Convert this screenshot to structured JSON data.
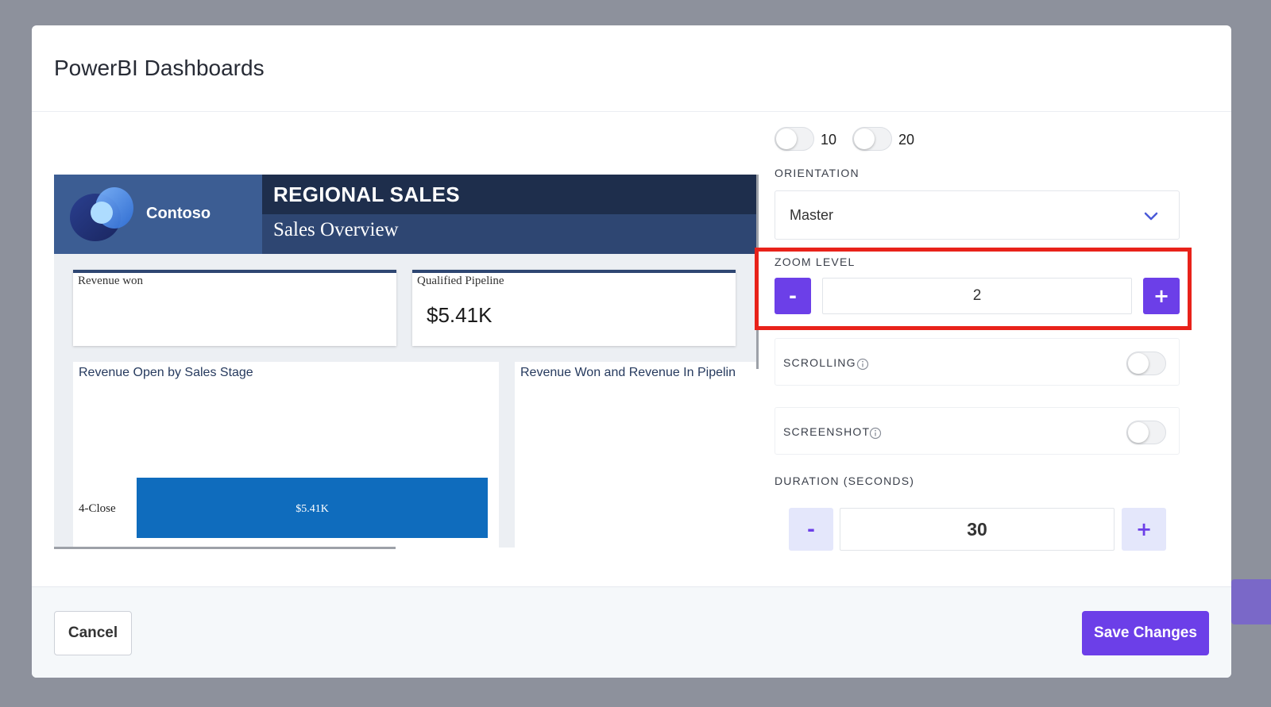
{
  "modal": {
    "title": "PowerBI Dashboards"
  },
  "report": {
    "brand": "Contoso",
    "title": "REGIONAL SALES",
    "subtitle": "Sales Overview",
    "kpis": [
      {
        "label": "Revenue won",
        "value": ""
      },
      {
        "label": "Qualified Pipeline",
        "value": "$5.41K"
      }
    ],
    "panels": {
      "revenue_open_title": "Revenue Open by Sales Stage",
      "revenue_won_title": "Revenue Won and Revenue In Pipelin"
    },
    "colors": {
      "brand_box": "#3c5d93",
      "title_dark": "#1e2e4c",
      "title_mid": "#2e4672",
      "bar": "#0f6cbd"
    }
  },
  "chart_data": {
    "type": "bar",
    "orientation": "horizontal",
    "categories": [
      "4-Close"
    ],
    "values": [
      5.41
    ],
    "value_labels": [
      "$5.41K"
    ],
    "title": "Revenue Open by Sales Stage",
    "xlabel": "",
    "ylabel": ""
  },
  "settings": {
    "toggles": [
      {
        "label": "10",
        "on": false
      },
      {
        "label": "20",
        "on": false
      }
    ],
    "orientation": {
      "label": "ORIENTATION",
      "value": "Master"
    },
    "zoom": {
      "label": "ZOOM LEVEL",
      "minus": "-",
      "plus": "+",
      "value": "2"
    },
    "scrolling": {
      "label": "SCROLLING",
      "on": false,
      "icon": "info-icon"
    },
    "screenshot": {
      "label": "SCREENSHOT",
      "on": false,
      "icon": "info-icon"
    },
    "duration": {
      "label": "DURATION (SECONDS)",
      "minus": "-",
      "plus": "+",
      "value": "30"
    },
    "colors": {
      "accent": "#6c3fe8",
      "highlight": "#e8221a"
    }
  },
  "footer": {
    "cancel_label": "Cancel",
    "save_label": "Save Changes"
  }
}
